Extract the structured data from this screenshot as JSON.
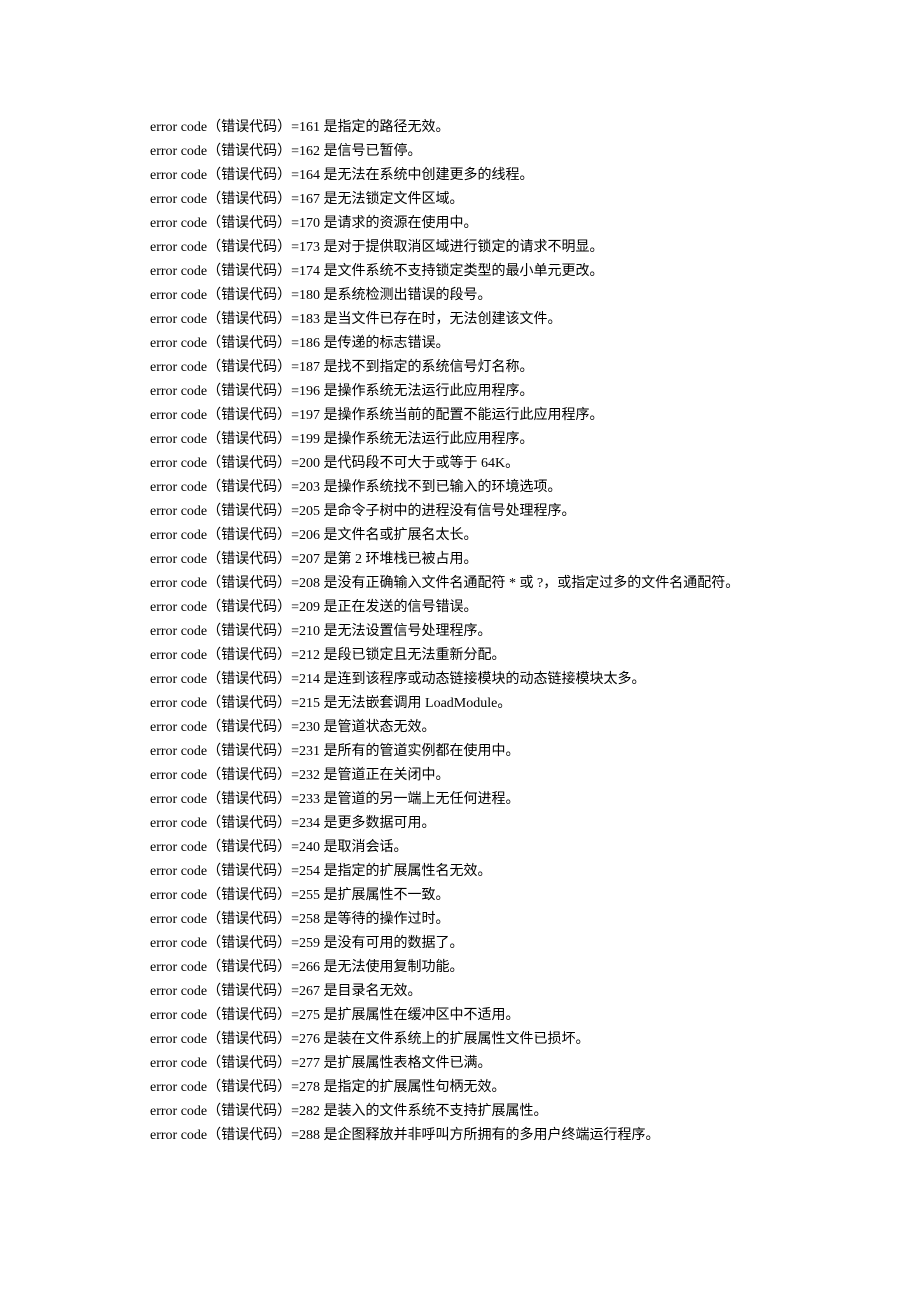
{
  "prefix": "error code（错误代码）=",
  "entries": [
    {
      "code": "161",
      "desc": "是指定的路径无效。"
    },
    {
      "code": "162",
      "desc": "是信号已暂停。"
    },
    {
      "code": "164",
      "desc": "是无法在系统中创建更多的线程。"
    },
    {
      "code": "167",
      "desc": "是无法锁定文件区域。"
    },
    {
      "code": "170",
      "desc": "是请求的资源在使用中。"
    },
    {
      "code": "173",
      "desc": "是对于提供取消区域进行锁定的请求不明显。"
    },
    {
      "code": "174",
      "desc": "是文件系统不支持锁定类型的最小单元更改。"
    },
    {
      "code": "180",
      "desc": "是系统检测出错误的段号。"
    },
    {
      "code": "183",
      "desc": "是当文件已存在时，无法创建该文件。"
    },
    {
      "code": "186",
      "desc": "是传递的标志错误。"
    },
    {
      "code": "187",
      "desc": "是找不到指定的系统信号灯名称。"
    },
    {
      "code": "196",
      "desc": "是操作系统无法运行此应用程序。"
    },
    {
      "code": "197",
      "desc": "是操作系统当前的配置不能运行此应用程序。"
    },
    {
      "code": "199",
      "desc": "是操作系统无法运行此应用程序。"
    },
    {
      "code": "200",
      "desc": "是代码段不可大于或等于 64K。"
    },
    {
      "code": "203",
      "desc": "是操作系统找不到已输入的环境选项。"
    },
    {
      "code": "205",
      "desc": "是命令子树中的进程没有信号处理程序。"
    },
    {
      "code": "206",
      "desc": "是文件名或扩展名太长。"
    },
    {
      "code": "207",
      "desc": "是第 2 环堆栈已被占用。"
    },
    {
      "code": "208",
      "desc": "是没有正确输入文件名通配符 * 或 ?，或指定过多的文件名通配符。"
    },
    {
      "code": "209",
      "desc": "是正在发送的信号错误。"
    },
    {
      "code": "210",
      "desc": "是无法设置信号处理程序。"
    },
    {
      "code": "212",
      "desc": "是段已锁定且无法重新分配。"
    },
    {
      "code": "214",
      "desc": "是连到该程序或动态链接模块的动态链接模块太多。"
    },
    {
      "code": "215",
      "desc": "是无法嵌套调用 LoadModule。"
    },
    {
      "code": "230",
      "desc": "是管道状态无效。"
    },
    {
      "code": "231",
      "desc": "是所有的管道实例都在使用中。"
    },
    {
      "code": "232",
      "desc": "是管道正在关闭中。"
    },
    {
      "code": "233",
      "desc": "是管道的另一端上无任何进程。"
    },
    {
      "code": "234",
      "desc": "是更多数据可用。"
    },
    {
      "code": "240",
      "desc": "是取消会话。"
    },
    {
      "code": "254",
      "desc": "是指定的扩展属性名无效。"
    },
    {
      "code": "255",
      "desc": "是扩展属性不一致。"
    },
    {
      "code": "258",
      "desc": "是等待的操作过时。"
    },
    {
      "code": "259",
      "desc": "是没有可用的数据了。"
    },
    {
      "code": "266",
      "desc": "是无法使用复制功能。"
    },
    {
      "code": "267",
      "desc": "是目录名无效。"
    },
    {
      "code": "275",
      "desc": "是扩展属性在缓冲区中不适用。"
    },
    {
      "code": "276",
      "desc": "是装在文件系统上的扩展属性文件已损坏。"
    },
    {
      "code": "277",
      "desc": "是扩展属性表格文件已满。"
    },
    {
      "code": "278",
      "desc": "是指定的扩展属性句柄无效。"
    },
    {
      "code": "282",
      "desc": "是装入的文件系统不支持扩展属性。"
    },
    {
      "code": "288",
      "desc": "是企图释放并非呼叫方所拥有的多用户终端运行程序。"
    }
  ]
}
